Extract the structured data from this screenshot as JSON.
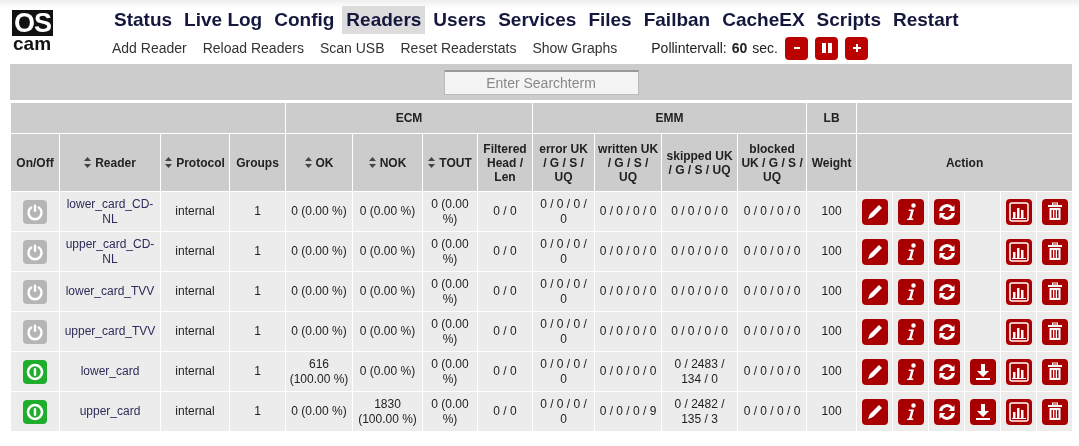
{
  "logo": {
    "top": "OS",
    "bottom": "cam"
  },
  "nav": [
    {
      "label": "Status",
      "selected": false
    },
    {
      "label": "Live Log",
      "selected": false
    },
    {
      "label": "Config",
      "selected": false
    },
    {
      "label": "Readers",
      "selected": true
    },
    {
      "label": "Users",
      "selected": false
    },
    {
      "label": "Services",
      "selected": false
    },
    {
      "label": "Files",
      "selected": false
    },
    {
      "label": "Failban",
      "selected": false
    },
    {
      "label": "CacheEX",
      "selected": false
    },
    {
      "label": "Scripts",
      "selected": false
    },
    {
      "label": "Restart",
      "selected": false
    }
  ],
  "subnav": [
    "Add Reader",
    "Reload Readers",
    "Scan USB",
    "Reset Readerstats",
    "Show Graphs"
  ],
  "poll": {
    "label": "Pollintervall:",
    "value": "60",
    "unit": "sec.",
    "buttons": [
      {
        "kind": "minus"
      },
      {
        "kind": "pause"
      },
      {
        "kind": "plus"
      }
    ]
  },
  "search": {
    "placeholder": "Enter Searchterm"
  },
  "column_groups": [
    {
      "columns": [
        {
          "label": "On/Off",
          "sortable": false
        },
        {
          "label": "Reader",
          "sortable": true
        },
        {
          "label": "Protocol",
          "sortable": true
        },
        {
          "label": "Groups",
          "sortable": false
        }
      ]
    },
    {
      "label": "ECM",
      "columns": [
        {
          "label": "OK",
          "sortable": true
        },
        {
          "label": "NOK",
          "sortable": true
        },
        {
          "label": "TOUT",
          "sortable": true
        },
        {
          "label": "Filtered Head / Len",
          "sortable": false
        }
      ]
    },
    {
      "label": "EMM",
      "columns": [
        {
          "label": "error UK / G / S / UQ",
          "sortable": false
        },
        {
          "label": "written UK / G / S / UQ",
          "sortable": false
        },
        {
          "label": "skipped UK / G / S / UQ",
          "sortable": false
        },
        {
          "label": "blocked UK / G / S / UQ",
          "sortable": false
        }
      ]
    },
    {
      "label": "LB",
      "columns": [
        {
          "label": "Weight",
          "sortable": false
        }
      ]
    },
    {
      "columns": [
        {
          "label": "Action",
          "sortable": false
        }
      ]
    }
  ],
  "rows": [
    {
      "enabled": false,
      "reader": "lower_card_CD-NL",
      "protocol": "internal",
      "groups": "1",
      "ok": "0 (0.00 %)",
      "nok": "0 (0.00 %)",
      "tout": "0 (0.00 %)",
      "filtered": "0 / 0",
      "error": "0 / 0 / 0 / 0",
      "written": "0 / 0 / 0 / 0",
      "skipped": "0 / 0 / 0 / 0",
      "blocked": "0 / 0 / 0 / 0",
      "weight": "100",
      "emm_download": false
    },
    {
      "enabled": false,
      "reader": "upper_card_CD-NL",
      "protocol": "internal",
      "groups": "1",
      "ok": "0 (0.00 %)",
      "nok": "0 (0.00 %)",
      "tout": "0 (0.00 %)",
      "filtered": "0 / 0",
      "error": "0 / 0 / 0 / 0",
      "written": "0 / 0 / 0 / 0",
      "skipped": "0 / 0 / 0 / 0",
      "blocked": "0 / 0 / 0 / 0",
      "weight": "100",
      "emm_download": false
    },
    {
      "enabled": false,
      "reader": "lower_card_TVV",
      "protocol": "internal",
      "groups": "1",
      "ok": "0 (0.00 %)",
      "nok": "0 (0.00 %)",
      "tout": "0 (0.00 %)",
      "filtered": "0 / 0",
      "error": "0 / 0 / 0 / 0",
      "written": "0 / 0 / 0 / 0",
      "skipped": "0 / 0 / 0 / 0",
      "blocked": "0 / 0 / 0 / 0",
      "weight": "100",
      "emm_download": false
    },
    {
      "enabled": false,
      "reader": "upper_card_TVV",
      "protocol": "internal",
      "groups": "1",
      "ok": "0 (0.00 %)",
      "nok": "0 (0.00 %)",
      "tout": "0 (0.00 %)",
      "filtered": "0 / 0",
      "error": "0 / 0 / 0 / 0",
      "written": "0 / 0 / 0 / 0",
      "skipped": "0 / 0 / 0 / 0",
      "blocked": "0 / 0 / 0 / 0",
      "weight": "100",
      "emm_download": false
    },
    {
      "enabled": true,
      "reader": "lower_card",
      "protocol": "internal",
      "groups": "1",
      "ok": "616 (100.00 %)",
      "nok": "0 (0.00 %)",
      "tout": "0 (0.00 %)",
      "filtered": "0 / 0",
      "error": "0 / 0 / 0 / 0",
      "written": "0 / 0 / 0 / 0",
      "skipped": "0 / 2483 / 134 / 0",
      "blocked": "0 / 0 / 0 / 0",
      "weight": "100",
      "emm_download": true
    },
    {
      "enabled": true,
      "reader": "upper_card",
      "protocol": "internal",
      "groups": "1",
      "ok": "0 (0.00 %)",
      "nok": "1830 (100.00 %)",
      "tout": "0 (0.00 %)",
      "filtered": "0 / 0",
      "error": "0 / 0 / 0 / 0",
      "written": "0 / 0 / 0 / 9",
      "skipped": "0 / 2482 / 135 / 3",
      "blocked": "0 / 0 / 0 / 0",
      "weight": "100",
      "emm_download": true
    }
  ]
}
